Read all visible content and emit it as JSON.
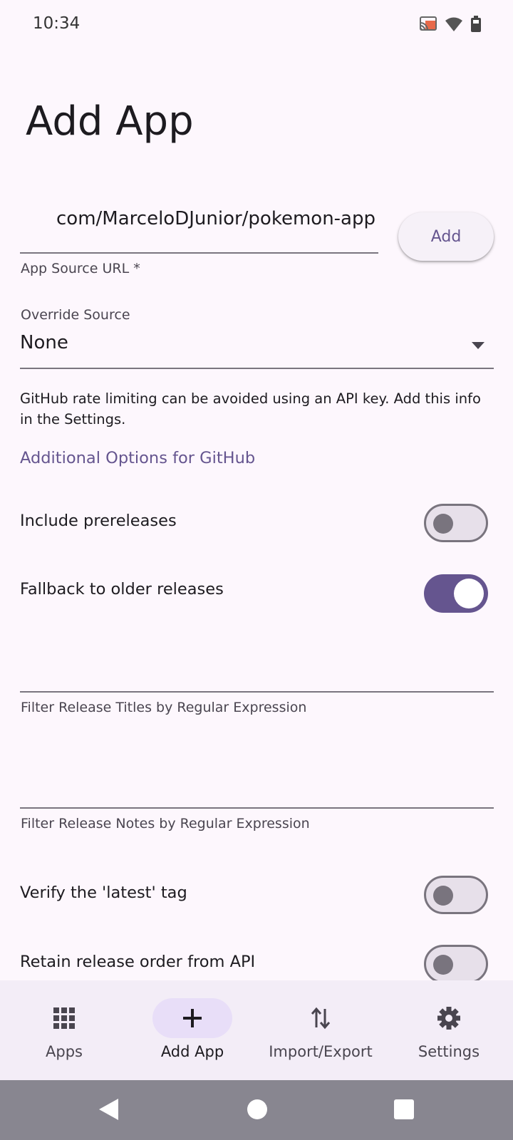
{
  "status_bar": {
    "time": "10:34",
    "icons": [
      "cast-icon",
      "wifi-icon",
      "battery-icon"
    ]
  },
  "page": {
    "title": "Add App"
  },
  "source_url": {
    "value": "com/MarceloDJunior/pokemon-app",
    "label": "App Source URL *",
    "add_button_label": "Add"
  },
  "override_source": {
    "label": "Override Source",
    "value": "None"
  },
  "info_text": "GitHub rate limiting can be avoided using an API key. Add this info in the Settings.",
  "section_heading": "Additional Options for GitHub",
  "options": {
    "include_prereleases": {
      "label": "Include prereleases",
      "enabled": false
    },
    "fallback_older": {
      "label": "Fallback to older releases",
      "enabled": true
    },
    "filter_titles": {
      "label": "Filter Release Titles by Regular Expression",
      "value": ""
    },
    "filter_notes": {
      "label": "Filter Release Notes by Regular Expression",
      "value": ""
    },
    "verify_latest": {
      "label": "Verify the 'latest' tag",
      "enabled": false
    },
    "retain_order": {
      "label": "Retain release order from API",
      "enabled": false
    }
  },
  "bottom_nav": {
    "items": [
      {
        "label": "Apps",
        "icon": "apps-grid-icon",
        "active": false
      },
      {
        "label": "Add App",
        "icon": "plus-icon",
        "active": true
      },
      {
        "label": "Import/Export",
        "icon": "import-export-icon",
        "active": false
      },
      {
        "label": "Settings",
        "icon": "gear-icon",
        "active": false
      }
    ]
  },
  "colors": {
    "background": "#fdf7fd",
    "accent": "#65558f",
    "nav_background": "#f3edf7",
    "nav_active_pill": "#e8def8",
    "system_nav": "#888690"
  }
}
